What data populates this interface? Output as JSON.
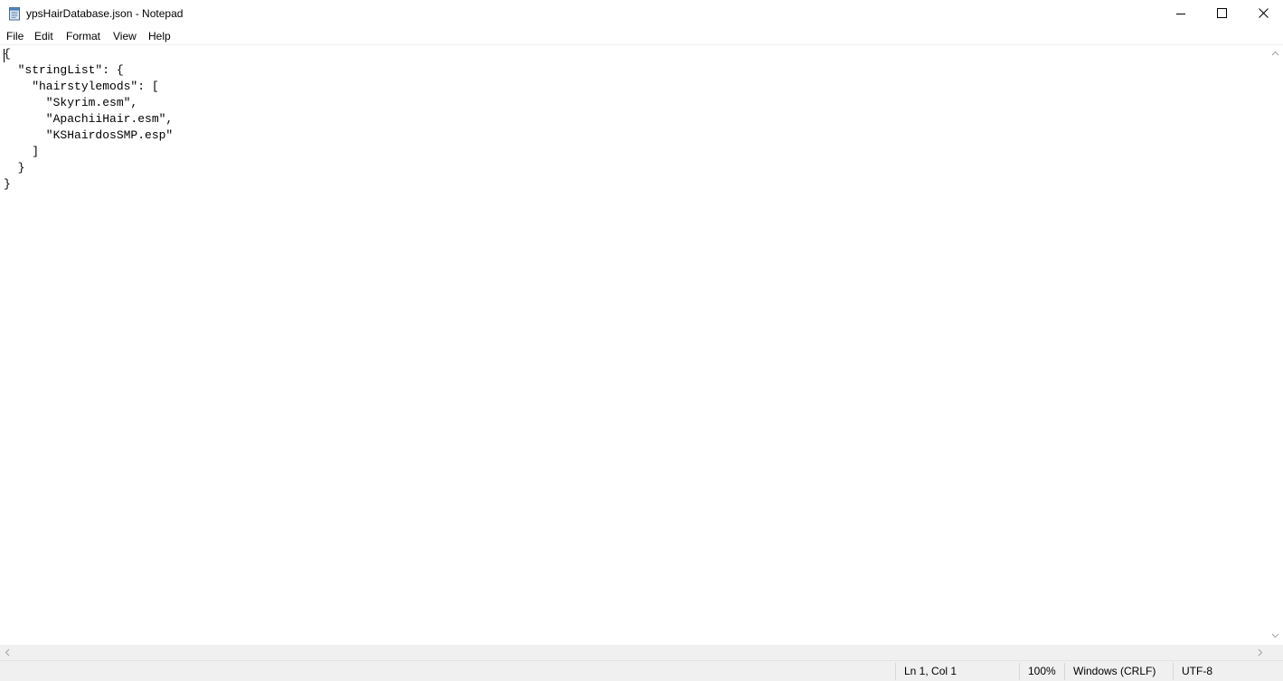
{
  "window": {
    "title": "ypsHairDatabase.json - Notepad",
    "app_icon": "notepad-icon"
  },
  "caption_buttons": {
    "minimize_icon": "minimize-icon",
    "maximize_icon": "maximize-icon",
    "close_icon": "close-icon"
  },
  "menu": {
    "items": [
      {
        "label": "File"
      },
      {
        "label": "Edit"
      },
      {
        "label": "Format"
      },
      {
        "label": "View"
      },
      {
        "label": "Help"
      }
    ]
  },
  "editor": {
    "lines": [
      "{",
      "  \"stringList\": {",
      "    \"hairstylemods\": [",
      "      \"Skyrim.esm\",",
      "      \"ApachiiHair.esm\",",
      "      \"KSHairdosSMP.esp\"",
      "    ]",
      "  }",
      "}"
    ]
  },
  "status": {
    "position": "Ln 1, Col 1",
    "zoom": "100%",
    "line_ending": "Windows (CRLF)",
    "encoding": "UTF-8"
  },
  "colors": {
    "background": "#ffffff",
    "chrome": "#f0f0f0",
    "text": "#000000"
  }
}
